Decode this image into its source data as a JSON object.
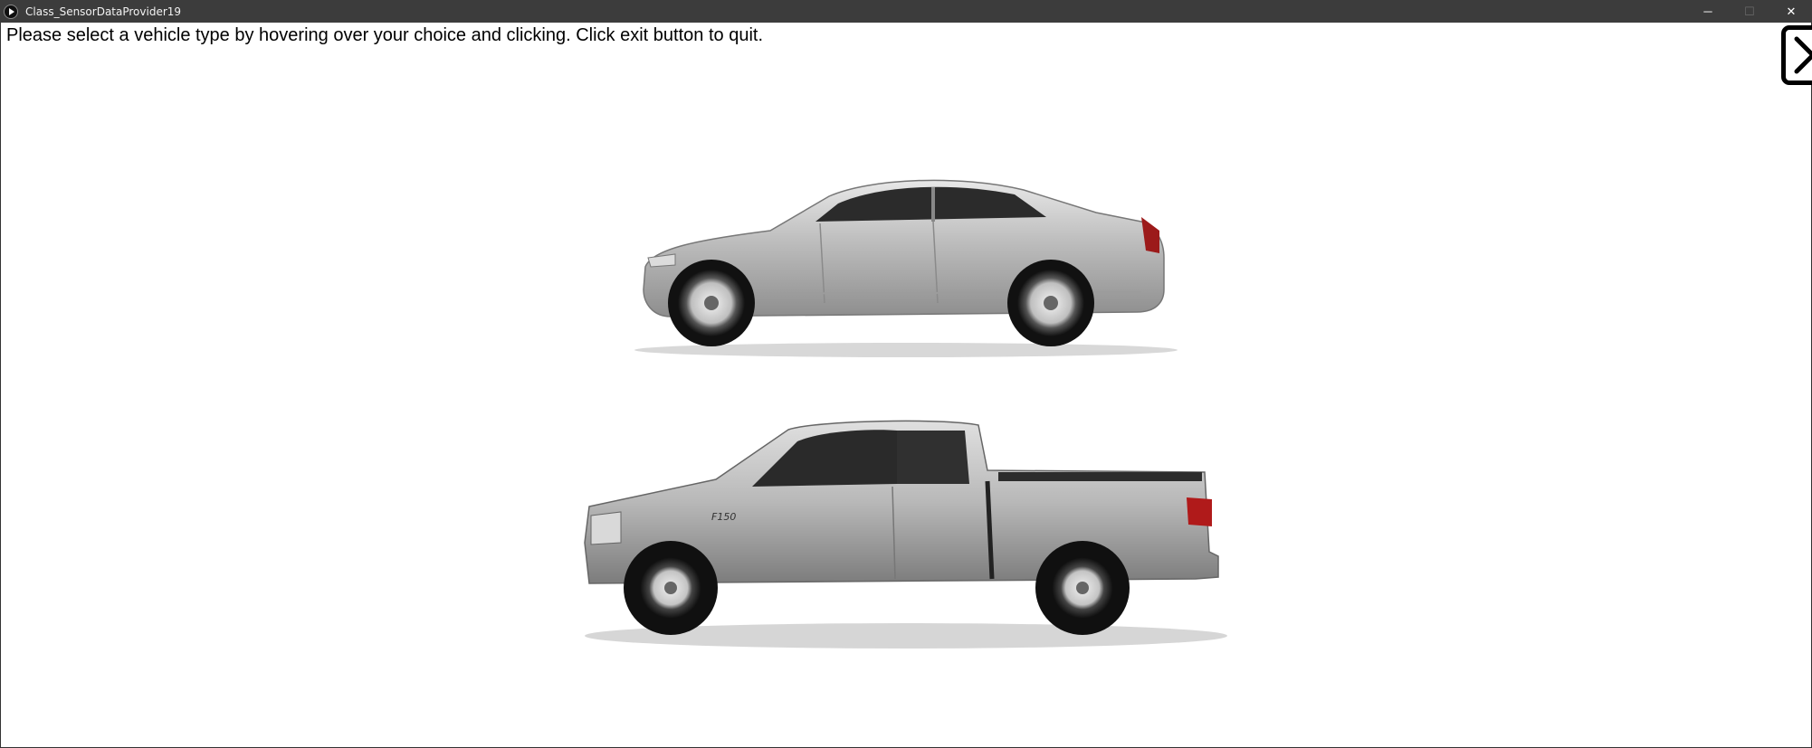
{
  "window": {
    "title": "Class_SensorDataProvider19",
    "controls": {
      "minimize": "─",
      "maximize": "☐",
      "close": "✕"
    }
  },
  "instructions": "Please select a vehicle type by hovering over your choice and clicking. Click exit button to quit.",
  "exit_button": {
    "icon": "close-x-icon"
  },
  "vehicles": [
    {
      "type": "sedan",
      "icon": "sedan-car-image",
      "color": "#c0c0c0"
    },
    {
      "type": "pickup-truck",
      "icon": "pickup-truck-image",
      "badge": "F150",
      "color": "#bdbdbd"
    }
  ]
}
